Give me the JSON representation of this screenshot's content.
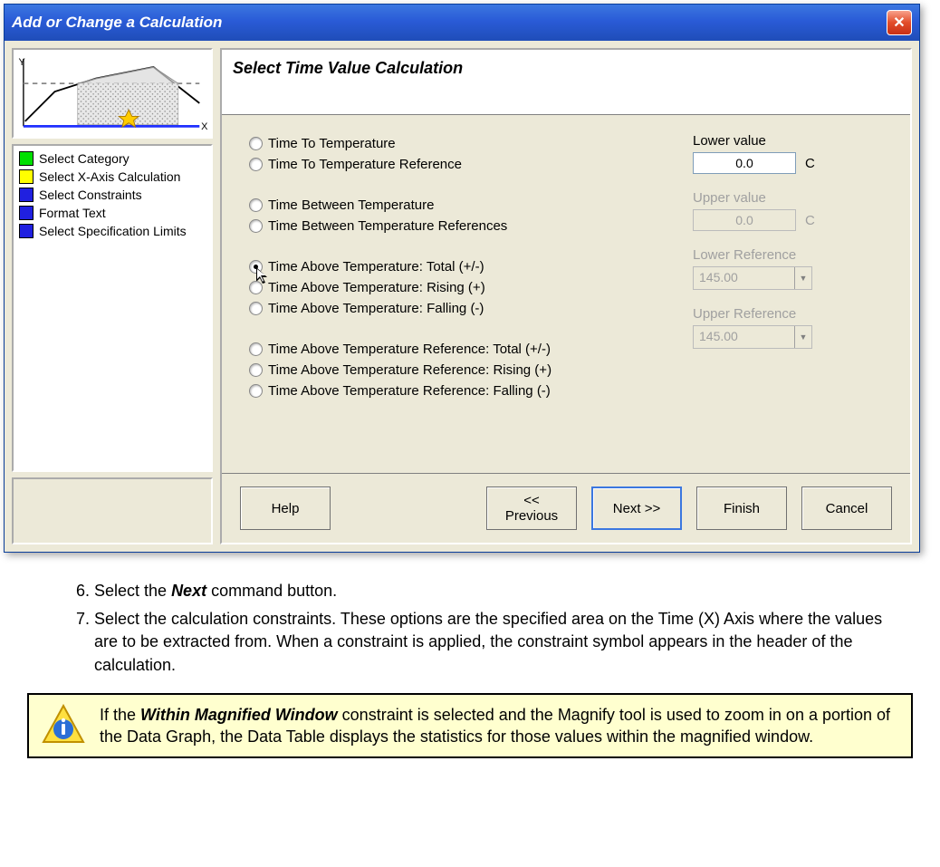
{
  "dialog": {
    "title": "Add or Change a Calculation",
    "header": "Select Time Value Calculation",
    "nav": [
      {
        "color": "#00e000",
        "label": "Select Category"
      },
      {
        "color": "#ffff00",
        "label": "Select X-Axis Calculation"
      },
      {
        "color": "#2020e0",
        "label": "Select Constraints"
      },
      {
        "color": "#2020e0",
        "label": "Format Text"
      },
      {
        "color": "#2020e0",
        "label": "Select Specification Limits"
      }
    ],
    "radios": {
      "group1": [
        {
          "id": "r1",
          "label": "Time To Temperature",
          "selected": false
        },
        {
          "id": "r2",
          "label": "Time To Temperature Reference",
          "selected": false
        }
      ],
      "group2": [
        {
          "id": "r3",
          "label": "Time Between Temperature",
          "selected": false
        },
        {
          "id": "r4",
          "label": "Time Between Temperature References",
          "selected": false
        }
      ],
      "group3": [
        {
          "id": "r5",
          "label": "Time Above Temperature: Total (+/-)",
          "selected": true,
          "cursor": true
        },
        {
          "id": "r6",
          "label": "Time Above Temperature: Rising (+)",
          "selected": false
        },
        {
          "id": "r7",
          "label": "Time Above Temperature: Falling (-)",
          "selected": false
        }
      ],
      "group4": [
        {
          "id": "r8",
          "label": "Time Above Temperature Reference: Total (+/-)",
          "selected": false
        },
        {
          "id": "r9",
          "label": "Time Above Temperature Reference: Rising (+)",
          "selected": false
        },
        {
          "id": "r10",
          "label": "Time Above Temperature Reference: Falling (-)",
          "selected": false
        }
      ]
    },
    "fields": {
      "lower_value": {
        "label": "Lower value",
        "value": "0.0",
        "unit": "C",
        "enabled": true
      },
      "upper_value": {
        "label": "Upper value",
        "value": "0.0",
        "unit": "C",
        "enabled": false
      },
      "lower_ref": {
        "label": "Lower Reference",
        "value": "145.00",
        "enabled": false
      },
      "upper_ref": {
        "label": "Upper Reference",
        "value": "145.00",
        "enabled": false
      }
    },
    "buttons": {
      "help": "Help",
      "prev": "<< Previous",
      "next": "Next >>",
      "finish": "Finish",
      "cancel": "Cancel"
    }
  },
  "instructions": {
    "step6_prefix": "Select the ",
    "step6_bold": "Next",
    "step6_suffix": " command button.",
    "step7": "Select the calculation constraints. These options are the specified area on the Time (X) Axis where the values are to be extracted from. When a constraint is applied, the constraint symbol appears in the header of the calculation."
  },
  "note": {
    "prefix": "If the ",
    "bold": "Within Magnified Window",
    "rest": " constraint is selected and the Magnify tool is used to zoom in on a portion of the Data Graph, the Data Table displays the statistics for those values within the magnified window."
  }
}
